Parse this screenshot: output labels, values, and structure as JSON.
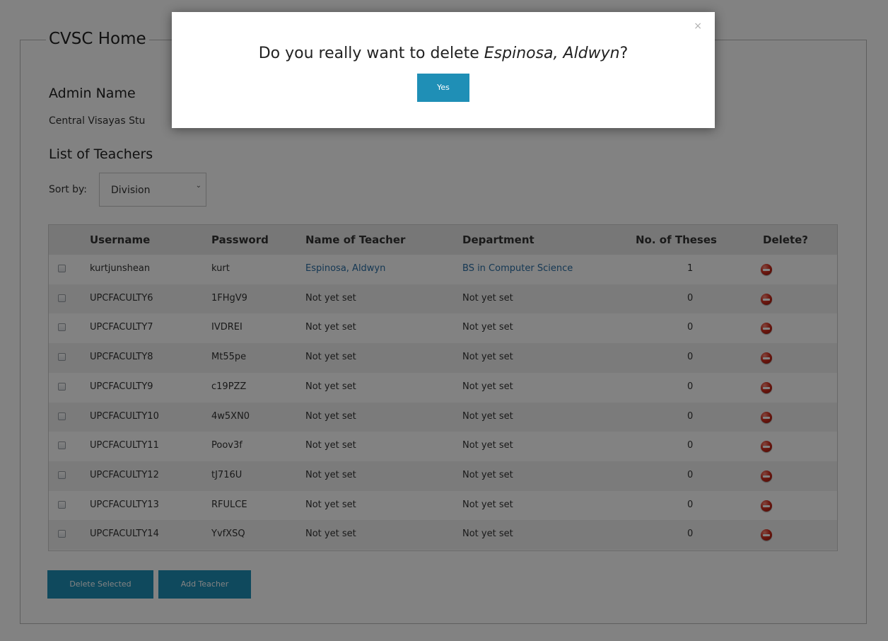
{
  "page": {
    "legend": "CVSC Home",
    "admin_label": "Admin Name",
    "admin_value": "Central Visayas Stu",
    "list_heading": "List of Teachers",
    "sort_label": "Sort by:",
    "sort_value": "Division"
  },
  "table": {
    "headers": [
      "Username",
      "Password",
      "Name of Teacher",
      "Department",
      "No. of Theses",
      "Delete?"
    ],
    "rows": [
      {
        "username": "kurtjunshean",
        "password": "kurt",
        "name": "Espinosa, Aldwyn",
        "department": "BS in Computer Science",
        "theses": "1"
      },
      {
        "username": "UPCFACULTY6",
        "password": "1FHgV9",
        "name": "Not yet set",
        "department": "Not yet set",
        "theses": "0"
      },
      {
        "username": "UPCFACULTY7",
        "password": "IVDREI",
        "name": "Not yet set",
        "department": "Not yet set",
        "theses": "0"
      },
      {
        "username": "UPCFACULTY8",
        "password": "Mt55pe",
        "name": "Not yet set",
        "department": "Not yet set",
        "theses": "0"
      },
      {
        "username": "UPCFACULTY9",
        "password": "c19PZZ",
        "name": "Not yet set",
        "department": "Not yet set",
        "theses": "0"
      },
      {
        "username": "UPCFACULTY10",
        "password": "4w5XN0",
        "name": "Not yet set",
        "department": "Not yet set",
        "theses": "0"
      },
      {
        "username": "UPCFACULTY11",
        "password": "Poov3f",
        "name": "Not yet set",
        "department": "Not yet set",
        "theses": "0"
      },
      {
        "username": "UPCFACULTY12",
        "password": "tJ716U",
        "name": "Not yet set",
        "department": "Not yet set",
        "theses": "0"
      },
      {
        "username": "UPCFACULTY13",
        "password": "RFULCE",
        "name": "Not yet set",
        "department": "Not yet set",
        "theses": "0"
      },
      {
        "username": "UPCFACULTY14",
        "password": "YvfXSQ",
        "name": "Not yet set",
        "department": "Not yet set",
        "theses": "0"
      }
    ]
  },
  "buttons": {
    "delete_selected": "Delete Selected",
    "add_teacher": "Add Teacher"
  },
  "modal": {
    "message_prefix": "Do you really want to delete ",
    "message_name": "Espinosa, Aldwyn",
    "message_suffix": "?",
    "yes_label": "Yes",
    "close_glyph": "×"
  },
  "colors": {
    "accent": "#1f8fb6",
    "link": "#2a6fa6"
  },
  "icons": {
    "delete": "delete-icon",
    "close": "close-icon"
  }
}
